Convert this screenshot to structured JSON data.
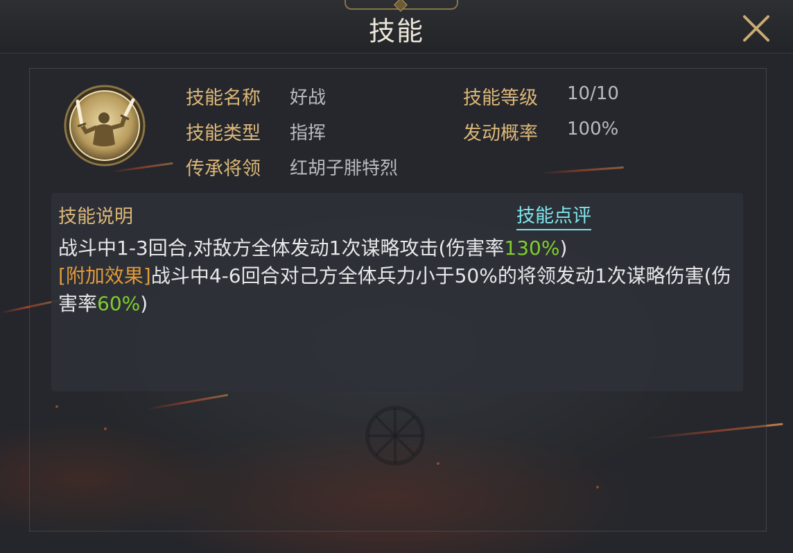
{
  "header": {
    "title": "技能",
    "close_icon": "close-x-icon"
  },
  "skill": {
    "icon": "commander-swords-medallion-icon",
    "name_label": "技能名称",
    "name_value": "好战",
    "level_label": "技能等级",
    "level_value": "10/10",
    "type_label": "技能类型",
    "type_value": "指挥",
    "chance_label": "发动概率",
    "chance_value": "100%",
    "inherit_label": "传承将领",
    "inherit_value": "红胡子腓特烈"
  },
  "description": {
    "title": "技能说明",
    "review_link": "技能点评",
    "line1_text": "战斗中1-3回合,对敌方全体发动1次谋略攻击(伤害率",
    "line1_rate": "130%",
    "line1_end": ")",
    "extra_tag": "[附加效果]",
    "line2_text": "战斗中4-6回合对己方全体兵力小于50%的将领发动1次谋略伤害(伤害率",
    "line2_rate": "60%",
    "line2_end": ")"
  },
  "colors": {
    "label_gold": "#dcb778",
    "value_gray": "#b9bcc2",
    "rate_green": "#7fcf2c",
    "tag_orange": "#e29a3a",
    "link_cyan": "#7ee4ec"
  }
}
